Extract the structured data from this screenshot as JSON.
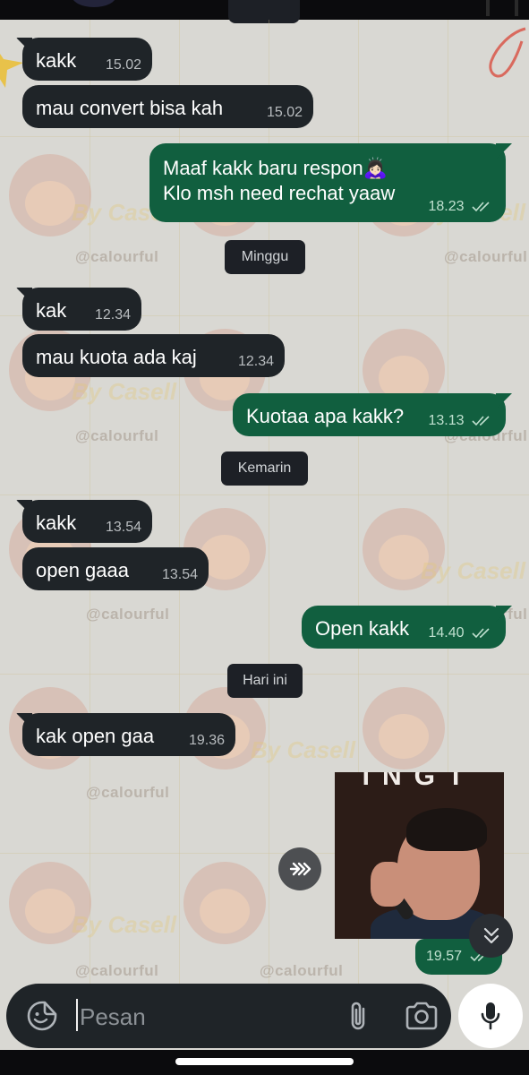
{
  "messages": [
    {
      "text": "kakk",
      "time": "15.02"
    },
    {
      "text": "mau convert bisa kah",
      "time": "15.02"
    },
    {
      "line1": "Maaf kakk baru respon",
      "line2": "Klo msh need rechat yaaw",
      "emoji": "🙇🏻‍♀️",
      "time": "18.23"
    },
    {
      "text": "kak",
      "time": "12.34"
    },
    {
      "text": "mau kuota ada kaj",
      "time": "12.34"
    },
    {
      "text": "Kuotaa apa kakk?",
      "time": "13.13"
    },
    {
      "text": "kakk",
      "time": "13.54"
    },
    {
      "text": "open gaaa",
      "time": "13.54"
    },
    {
      "text": "Open kakk",
      "time": "14.40"
    },
    {
      "text": "kak open gaa",
      "time": "19.36"
    }
  ],
  "date_chips": [
    "Minggu",
    "Kemarin",
    "Hari ini"
  ],
  "sticker": {
    "caption": "INGT",
    "time": "19.57"
  },
  "wallpaper": {
    "handle": "@calourful",
    "brand": "By Casell"
  },
  "composer": {
    "placeholder": "Pesan"
  },
  "icons": {
    "forward": "forward-icon",
    "scroll": "double-chevron-down-icon",
    "emoji": "sticker-icon",
    "attach": "paperclip-icon",
    "camera": "camera-icon",
    "mic": "microphone-icon",
    "ticks": "double-check-icon"
  },
  "colors": {
    "incoming": "#1f2428",
    "outgoing": "#115f3f",
    "chip": "#1d2026"
  }
}
